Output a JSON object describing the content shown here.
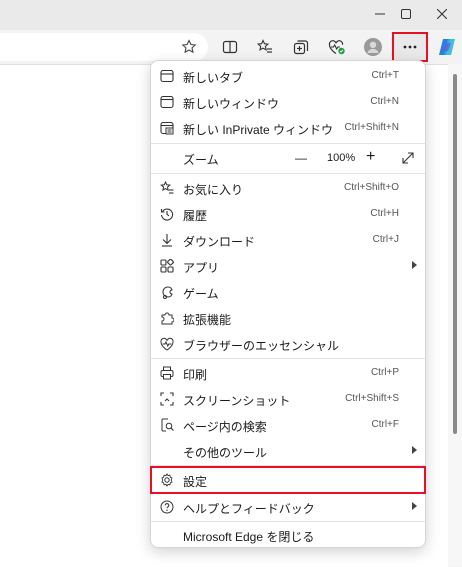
{
  "colors": {
    "highlight": "#e81123",
    "copilot": "#2b7fe0"
  },
  "window": {
    "minimize": "minimize-icon",
    "maximize": "maximize-icon",
    "close": "close-icon"
  },
  "toolbar_icons": [
    "star-icon",
    "split-screen-icon",
    "favorites-icon",
    "collections-icon",
    "browser-essentials-icon",
    "profile-avatar",
    "more-icon",
    "copilot-icon"
  ],
  "menu": {
    "new_tab": {
      "label": "新しいタブ",
      "shortcut": "Ctrl+T"
    },
    "new_window": {
      "label": "新しいウィンドウ",
      "shortcut": "Ctrl+N"
    },
    "new_inprivate": {
      "label": "新しい InPrivate ウィンドウ",
      "shortcut": "Ctrl+Shift+N"
    },
    "zoom": {
      "label": "ズーム",
      "minus": "—",
      "value": "100%",
      "plus": "+"
    },
    "favorites": {
      "label": "お気に入り",
      "shortcut": "Ctrl+Shift+O"
    },
    "history": {
      "label": "履歴",
      "shortcut": "Ctrl+H"
    },
    "downloads": {
      "label": "ダウンロード",
      "shortcut": "Ctrl+J"
    },
    "apps": {
      "label": "アプリ"
    },
    "games": {
      "label": "ゲーム"
    },
    "extensions": {
      "label": "拡張機能"
    },
    "essentials": {
      "label": "ブラウザーのエッセンシャル"
    },
    "print": {
      "label": "印刷",
      "shortcut": "Ctrl+P"
    },
    "screenshot": {
      "label": "スクリーンショット",
      "shortcut": "Ctrl+Shift+S"
    },
    "find": {
      "label": "ページ内の検索",
      "shortcut": "Ctrl+F"
    },
    "more_tools": {
      "label": "その他のツール"
    },
    "settings": {
      "label": "設定"
    },
    "help": {
      "label": "ヘルプとフィードバック"
    },
    "close_edge": {
      "label": "Microsoft Edge を閉じる"
    }
  }
}
